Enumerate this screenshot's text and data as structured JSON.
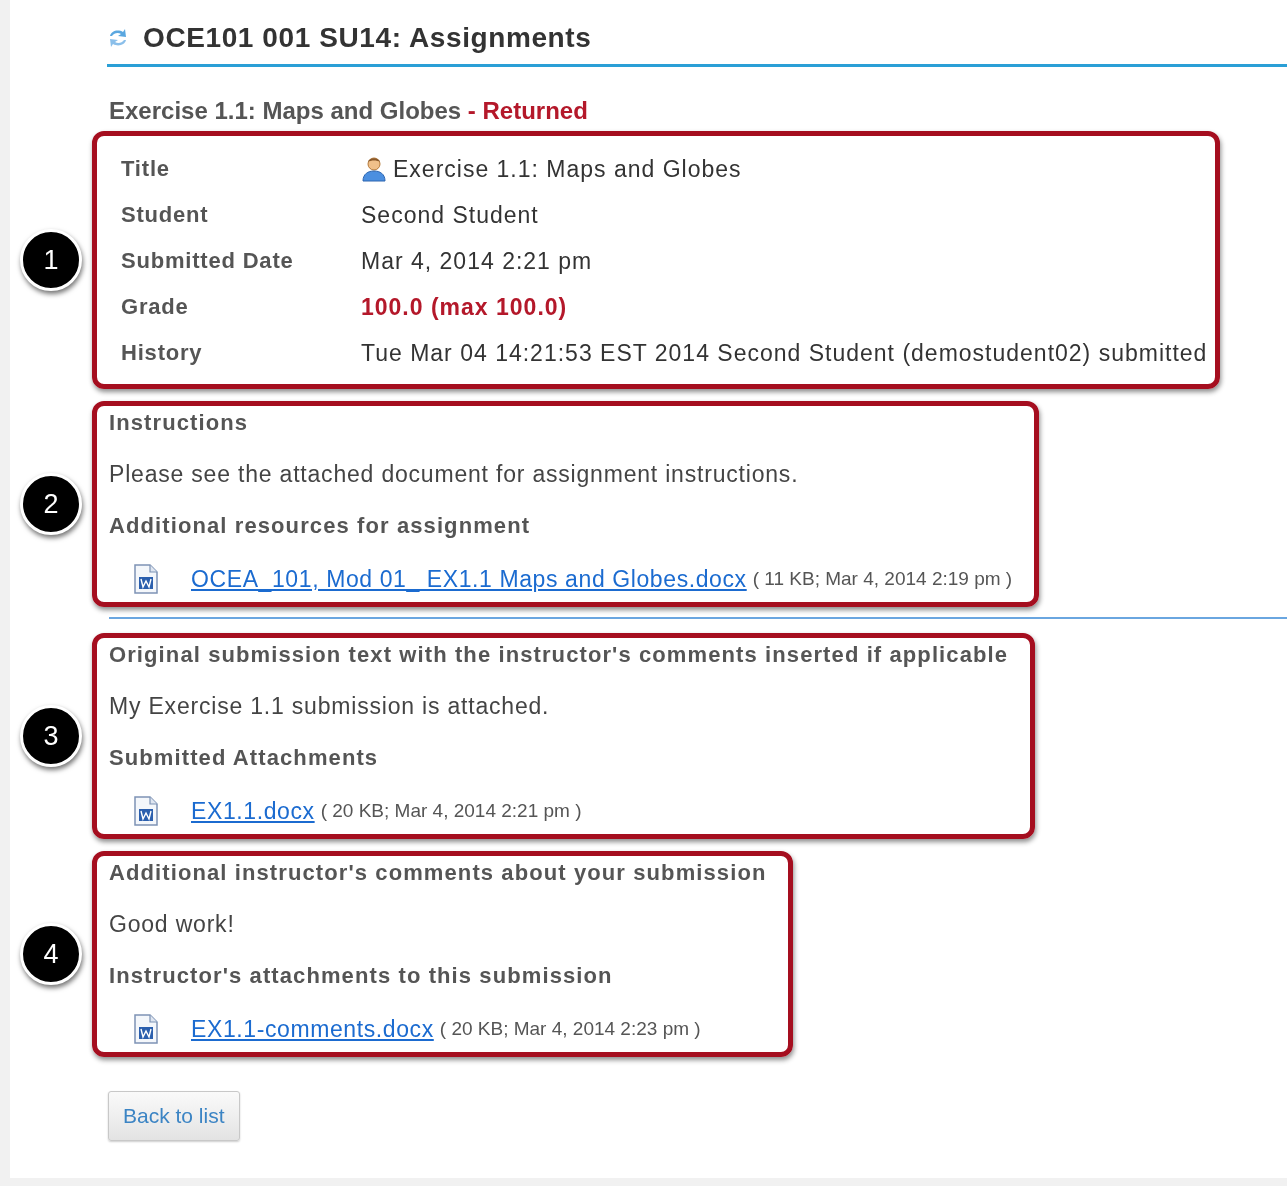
{
  "header": {
    "title": "OCE101 001 SU14: Assignments"
  },
  "assignment": {
    "name": "Exercise 1.1: Maps and Globes",
    "status": "- Returned"
  },
  "sections": [
    {
      "callout": "1",
      "kind": "details",
      "rows": [
        {
          "label": "Title",
          "value": "Exercise 1.1: Maps and Globes",
          "kind": "title"
        },
        {
          "label": "Student",
          "value": "Second Student",
          "kind": "plain"
        },
        {
          "label": "Submitted Date",
          "value": "Mar 4, 2014 2:21 pm",
          "kind": "plain"
        },
        {
          "label": "Grade",
          "value": "100.0 (max 100.0)",
          "kind": "grade"
        },
        {
          "label": "History",
          "value": "Tue Mar 04 14:21:53 EST 2014 Second Student (demostudent02) submitted",
          "kind": "plain"
        }
      ]
    },
    {
      "callout": "2",
      "kind": "text",
      "heading": "Instructions",
      "text": "Please see the attached document for assignment instructions.",
      "attachments_heading": "Additional resources for assignment",
      "attachments": [
        {
          "name": "OCEA_101, Mod 01_ EX1.1 Maps and Globes.docx",
          "meta": "( 11 KB; Mar 4, 2014 2:19 pm )"
        }
      ],
      "divider_after": true
    },
    {
      "callout": "3",
      "kind": "text",
      "heading": "Original submission text with the instructor's comments inserted if applicable",
      "text": "My Exercise 1.1 submission is attached.",
      "attachments_heading": "Submitted Attachments",
      "attachments": [
        {
          "name": "EX1.1.docx",
          "meta": "( 20 KB; Mar 4, 2014 2:21 pm )"
        }
      ],
      "divider_after": false
    },
    {
      "callout": "4",
      "kind": "text",
      "heading": "Additional instructor's comments about your submission",
      "text": "Good work!",
      "attachments_heading": "Instructor's attachments to this submission",
      "attachments": [
        {
          "name": "EX1.1-comments.docx",
          "meta": "( 20 KB; Mar 4, 2014 2:23 pm )"
        }
      ],
      "divider_after": false
    }
  ],
  "buttons": [
    "Back to list"
  ]
}
